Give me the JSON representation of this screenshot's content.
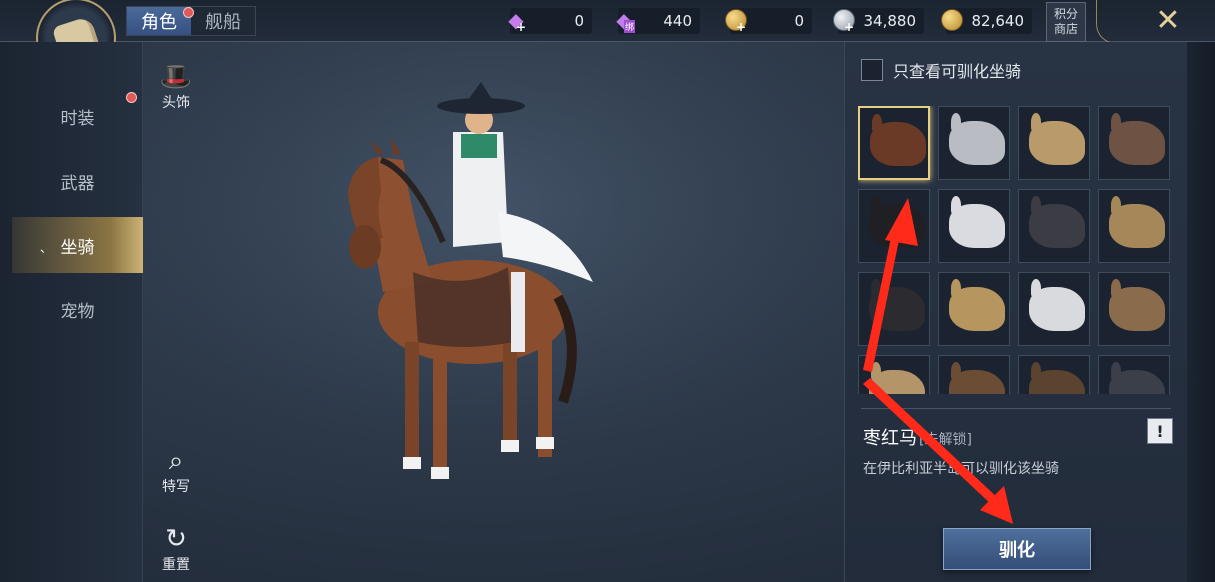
{
  "header": {
    "tabs": [
      {
        "label": "角色",
        "active": true,
        "badge": true
      },
      {
        "label": "舰船",
        "active": false,
        "badge": false
      }
    ],
    "currencies": [
      {
        "icon": "purple-diamond-icon",
        "value": "0",
        "suffix": "plus"
      },
      {
        "icon": "bound-purple-diamond-icon",
        "value": "440",
        "suffix": "绑"
      },
      {
        "icon": "gold-coin-icon",
        "value": "0",
        "suffix": "plus"
      },
      {
        "icon": "silver-coin-icon",
        "value": "34,880",
        "suffix": "plus"
      },
      {
        "icon": "gold-coins-stack-icon",
        "value": "82,640",
        "suffix": ""
      }
    ],
    "shop_label": "积分商店",
    "close_icon": "close-icon"
  },
  "sidebar": {
    "items": [
      {
        "label": "时装",
        "active": false,
        "badge": true
      },
      {
        "label": "武器",
        "active": false,
        "badge": false
      },
      {
        "label": "坐骑",
        "active": true,
        "badge": false
      },
      {
        "label": "宠物",
        "active": false,
        "badge": false
      }
    ]
  },
  "tools": {
    "headwear_label": "头饰",
    "closeup_label": "特写",
    "reset_label": "重置"
  },
  "panel": {
    "filter_label": "只查看可驯化坐骑",
    "filter_checked": false,
    "mounts": [
      {
        "kind": "horse",
        "color": "#6b3a26",
        "selected": true
      },
      {
        "kind": "horse",
        "color": "#b9bcc2",
        "selected": false
      },
      {
        "kind": "camel",
        "color": "#b99a6a",
        "selected": false
      },
      {
        "kind": "camel",
        "color": "#6e5344",
        "selected": false
      },
      {
        "kind": "horse",
        "color": "#1f1f24",
        "selected": false
      },
      {
        "kind": "horse",
        "color": "#d9dbe0",
        "selected": false
      },
      {
        "kind": "armored-horse",
        "color": "#3c3c44",
        "selected": false
      },
      {
        "kind": "armored-horse",
        "color": "#a5875a",
        "selected": false
      },
      {
        "kind": "armored-horse",
        "color": "#2b2b30",
        "selected": false
      },
      {
        "kind": "deer",
        "color": "#b7955e",
        "selected": false
      },
      {
        "kind": "deer",
        "color": "#d8dadd",
        "selected": false
      },
      {
        "kind": "camel",
        "color": "#8a6c4c",
        "selected": false
      },
      {
        "kind": "camel",
        "color": "#b4956a",
        "selected": false
      },
      {
        "kind": "deer",
        "color": "#6a4d34",
        "selected": false
      },
      {
        "kind": "deer",
        "color": "#5a432f",
        "selected": false
      },
      {
        "kind": "horse",
        "color": "#3a3f4a",
        "selected": false
      }
    ],
    "mount_name": "枣红马",
    "mount_status": "[未解锁]",
    "info_label": "!",
    "mount_desc": "在伊比利亚半岛可以驯化该坐骑",
    "tame_label": "驯化"
  },
  "colors": {
    "accent_gold": "#cdb376",
    "annotation_red": "#ff2a1a",
    "button_blue": "#4f6f9c"
  }
}
